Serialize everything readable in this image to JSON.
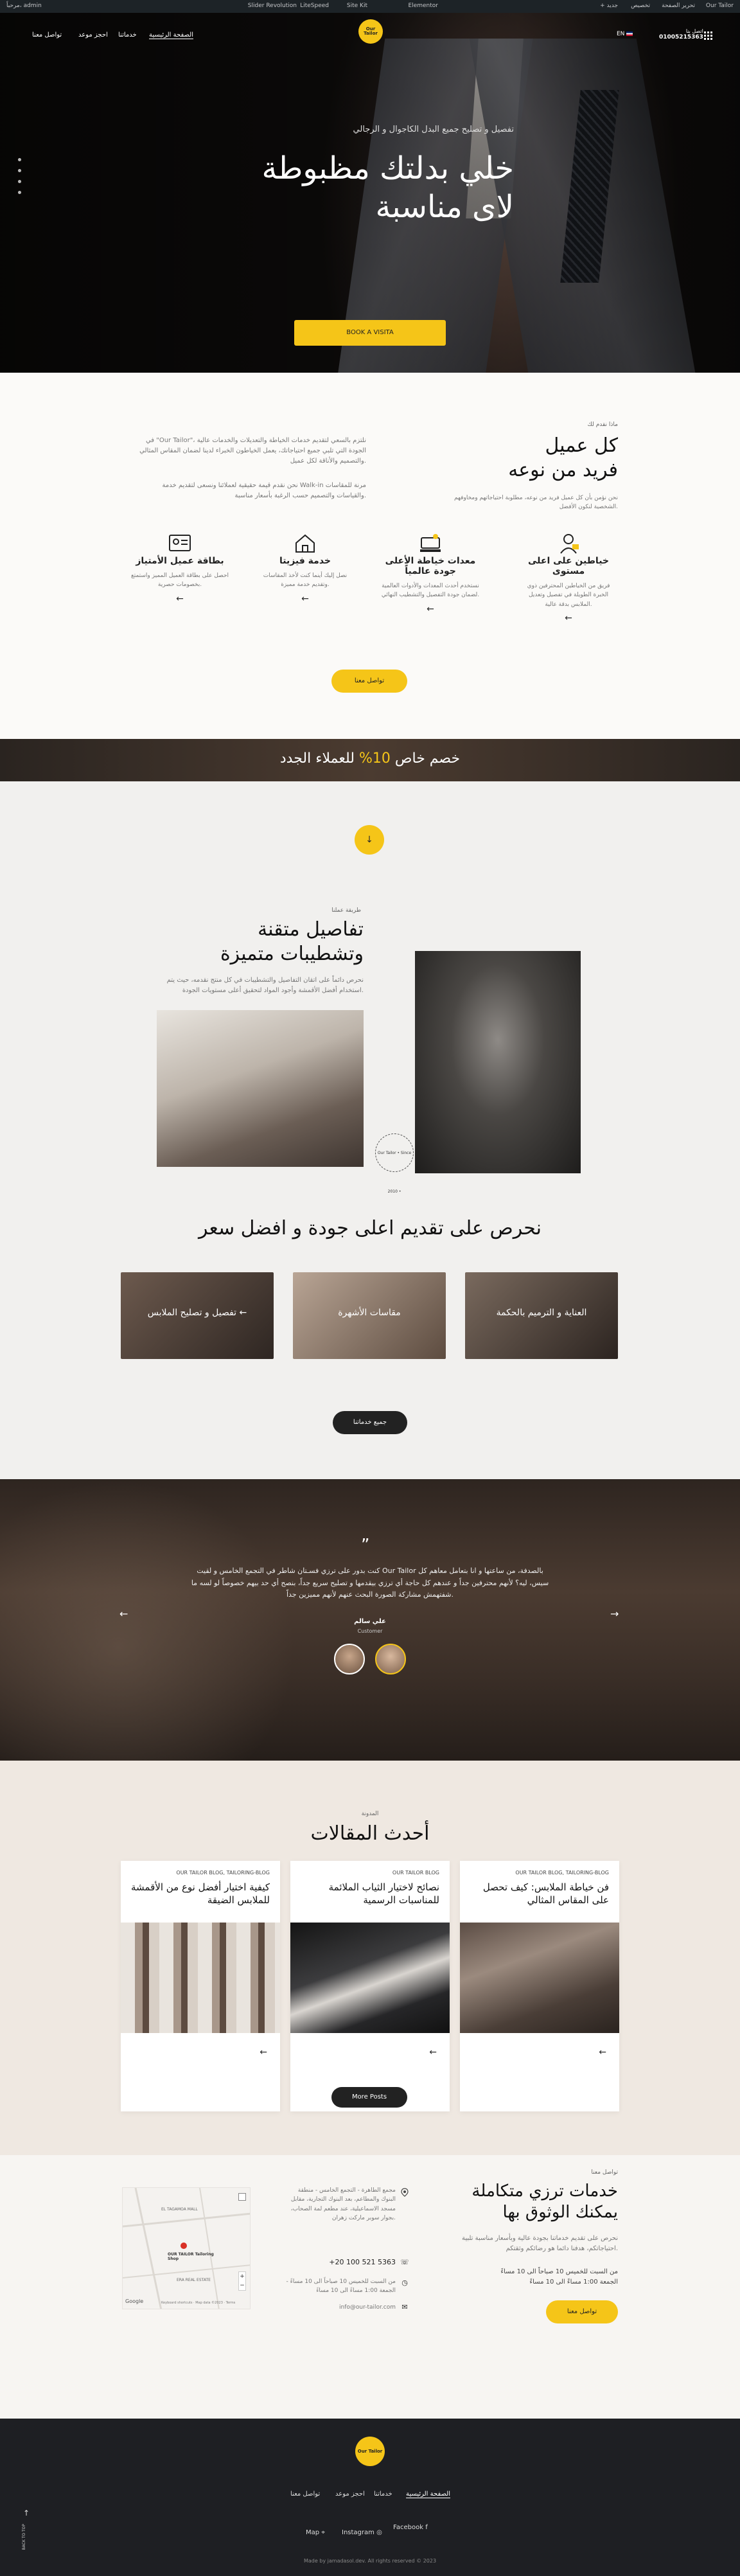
{
  "adminbar": {
    "site": "Our Tailor",
    "edit": "تحرير الصفحة",
    "customize": "تخصيص",
    "new": "+ جديد",
    "elementor": "Elementor",
    "siteKit": "Site Kit",
    "litespeed": "LiteSpeed",
    "slider": "Slider Revolution",
    "user": "مرحباً، admin"
  },
  "header": {
    "nav": [
      "الصفحة الرئيسية",
      "خدماتنا",
      "احجز موعد",
      "تواصل معنا"
    ],
    "call_label": "اتصل بنا",
    "phone": "01005215363",
    "lang_code": "EN",
    "logo_text": "Our Tailor"
  },
  "hero": {
    "subtitle": "تفصيل و تصليح جميع البدل الكاجوال و الرجالي",
    "title_line1": "خلي بدلتك مظبوطة",
    "title_line2": "لاى مناسبة",
    "cta": "BOOK A VISITA"
  },
  "about": {
    "label": "ماذا نقدم لك",
    "title_line1": "كل عميل",
    "title_line2": "فريد من نوعه",
    "desc": "نحن نؤمن بأن كل عميل فريد من نوعه، مطلوبة احتياجاتهم ومخاوفهم الشخصية لنكون الأفضل.",
    "para1": "في \"Our Tailor\"، نلتزم بالسعي لتقديم خدمات الخياطة والتعديلات والخدمات عالية الجودة التي تلبي جميع احتياجاتك، يعمل الخياطون الخبراء لدينا لضمان المقاس المثالي والتصميم والأناقة لكل عميل.",
    "para2": "نحن نقدم قيمة حقيقية لعملائنا ونسعى لتقديم خدمة Walk-in مرنة للمقاسات والقياسات والتصميم حسب الرغبة بأسعار مناسبة.",
    "features": [
      {
        "title": "خياطين على اعلى مستوى",
        "desc": "فريق من الخياطين المحترفين ذوي الخبرة الطويلة في تفصيل وتعديل الملابس بدقة عالية."
      },
      {
        "title": "معدات خياطة الأعلى جودة عالمياً",
        "desc": "نستخدم أحدث المعدات والأدوات العالمية لضمان جودة التفصيل والتشطيب النهائي."
      },
      {
        "title": "خدمة فيزيتا",
        "desc": "نصل إليك أينما كنت لأخذ المقاسات وتقديم خدمة مميزة."
      },
      {
        "title": "بطاقة عميل الأمتياز",
        "desc": "احصل على بطاقة العميل المميز واستمتع بخصومات حصرية."
      }
    ],
    "contact_btn": "تواصل معنا"
  },
  "promo": {
    "text_pre": "خصم خاص ",
    "highlight": "10%",
    "text_post": " للعملاء الجدد"
  },
  "details": {
    "label": "طريقة عملنا",
    "title_line1": "تفاصيل متقنة",
    "title_line2": "وتشطيبات متميزة",
    "desc": "نحرص دائماً على اتقان التفاصيل والتشطيبات في كل منتج نقدمه، حيث يتم استخدام أفضل الأقمشة وأجود المواد لتحقيق أعلى مستويات الجودة.",
    "circle_text": "Our Tailor • Since 2010 •"
  },
  "services": {
    "title": "نحرص على تقديم اعلى جودة و افضل سعر",
    "items": [
      "تفصيل و تصليح الملابس",
      "مقاسات الأشهرة",
      "العناية و الترميم بالحكمة"
    ],
    "all_btn": "جميع خدماتنا"
  },
  "testimonial": {
    "text": "كنت بدور على ترزي فسـتان شاطر في التجمع الخامس و لقيت Our Tailor بالصدفة، من ساعتها و انا بتعامل معاهم كل سيس، ليه؟ لأنهم محترفين جداً و عندهم كل حاجة أي ترزي بيقدمها و تصليح سريع جداً، بنصح أي حد بيهم خصوصاً لو لسه ما شفتهمش مشاركة الصورة البحث عنهم لأنهم مميزين جداً.",
    "name": "علي سالم",
    "role": "Customer"
  },
  "blog": {
    "label": "المدونة",
    "title": "أحدث المقالات",
    "posts": [
      {
        "cat": "OUR TAILOR BLOG, TAILORING-BLOG",
        "title": "فن خياطة الملابس: كيف تحصل على المقاس المثالي"
      },
      {
        "cat": "OUR TAILOR BLOG",
        "title": "نصائح لاختيار الثياب الملائمة للمناسبات الرسمية"
      },
      {
        "cat": "OUR TAILOR BLOG, TAILORING-BLOG",
        "title": "كيفية اختيار أفضل نوع من الأقمشة للملابس الضيقة"
      }
    ],
    "more_btn": "More Posts"
  },
  "contact": {
    "label": "تواصل معنا",
    "title_line1": "خدمات ترزي متكاملة",
    "title_line2": "يمكنك الوثوق بها",
    "desc": "نحرص على تقديم خدماتنا بجودة عالية وبأسعار مناسبة تلبية احتياجاتكم، هدفنا دائما هو رضائكم وثقتكم.",
    "hours1": "من السبت للخميس 10 صباحاً الى 10 مساءً",
    "hours2": "الجمعة 1:00 مساءً الى 10 مساءً",
    "btn": "تواصل معنا",
    "address": "مجمع الطاهرة - التجمع الخامس - منطقة البنوك والمطاعم، بعد البنوك التجارية، مقابل مسجد الاسماعيلية، عند مطعم لمة الصحاب، بجوار سوبر ماركت زهران.",
    "phone": "+20 100 521 5363",
    "hours_addr": "من السبت للخميس 10 صباحاً الى 10 مساءً - الجمعة 1:00 مساءً الى 10 مساءً",
    "email": "info@our-tailor.com",
    "map_label1": "EL TAGAMOA MALL",
    "map_label2": "OUR TAILOR Tailoring Shop",
    "map_label3": "ERA REAL ESTATE",
    "map_google": "Google",
    "map_footer": "Keyboard shortcuts · Map data ©2023 · Terms"
  },
  "footer": {
    "nav": [
      "الصفحة الرئيسية",
      "خدماتنا",
      "احجز موعد",
      "تواصل معنا"
    ],
    "social": [
      "Facebook",
      "Instagram",
      "Map"
    ],
    "copyright": "Made by jamadasol.dev. All rights reserved © 2023",
    "back_to_top": "BACK TO TOP"
  },
  "colors": {
    "accent": "#f5c518",
    "dark": "#1e1f23"
  }
}
